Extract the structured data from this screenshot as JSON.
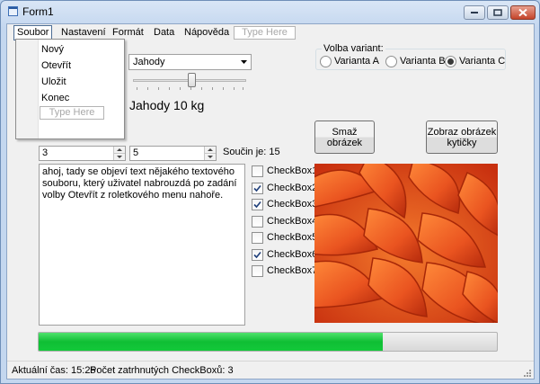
{
  "window": {
    "title": "Form1"
  },
  "menu": {
    "items": [
      "Soubor",
      "Nastavení",
      "Formát",
      "Data",
      "Nápověda"
    ],
    "type_here": "Type Here",
    "dropdown": [
      "Nový",
      "Otevřít",
      "Uložit",
      "Konec"
    ],
    "dropdown_type_here": "Type Here"
  },
  "combo": {
    "selected": "Jahody"
  },
  "slider": {
    "level": 0.5
  },
  "product_label": "Jahody 10 kg",
  "variants": {
    "title": "Volba variant:",
    "options": [
      {
        "label": "Varianta A",
        "checked": false
      },
      {
        "label": "Varianta B",
        "checked": false
      },
      {
        "label": "Varianta C",
        "checked": true
      }
    ]
  },
  "buttons": {
    "delete_image": "Smaž obrázek",
    "show_image": "Zobraz obrázek kytičky"
  },
  "numbers": {
    "a": "3",
    "b": "5",
    "product_label": "Součin je: 15"
  },
  "textbox": "ahoj, tady se objeví text nějakého textového souboru, který uživatel nabrouzdá po zadání volby Otevřít z roletkového menu nahoře.",
  "checkboxes": [
    {
      "label": "CheckBox1",
      "checked": false
    },
    {
      "label": "CheckBox2",
      "checked": true
    },
    {
      "label": "CheckBox3",
      "checked": true
    },
    {
      "label": "CheckBox4",
      "checked": false
    },
    {
      "label": "CheckBox5",
      "checked": false
    },
    {
      "label": "CheckBox6",
      "checked": true
    },
    {
      "label": "CheckBox7",
      "checked": false
    }
  ],
  "progress": {
    "value": 0.75,
    "color": "#18c43c"
  },
  "status": {
    "time": "Aktuální čas: 15:25",
    "count": "Počet zatrhnutých CheckBoxů: 3"
  },
  "colors": {
    "accent": "#18c43c",
    "flower": "#e8501e"
  }
}
